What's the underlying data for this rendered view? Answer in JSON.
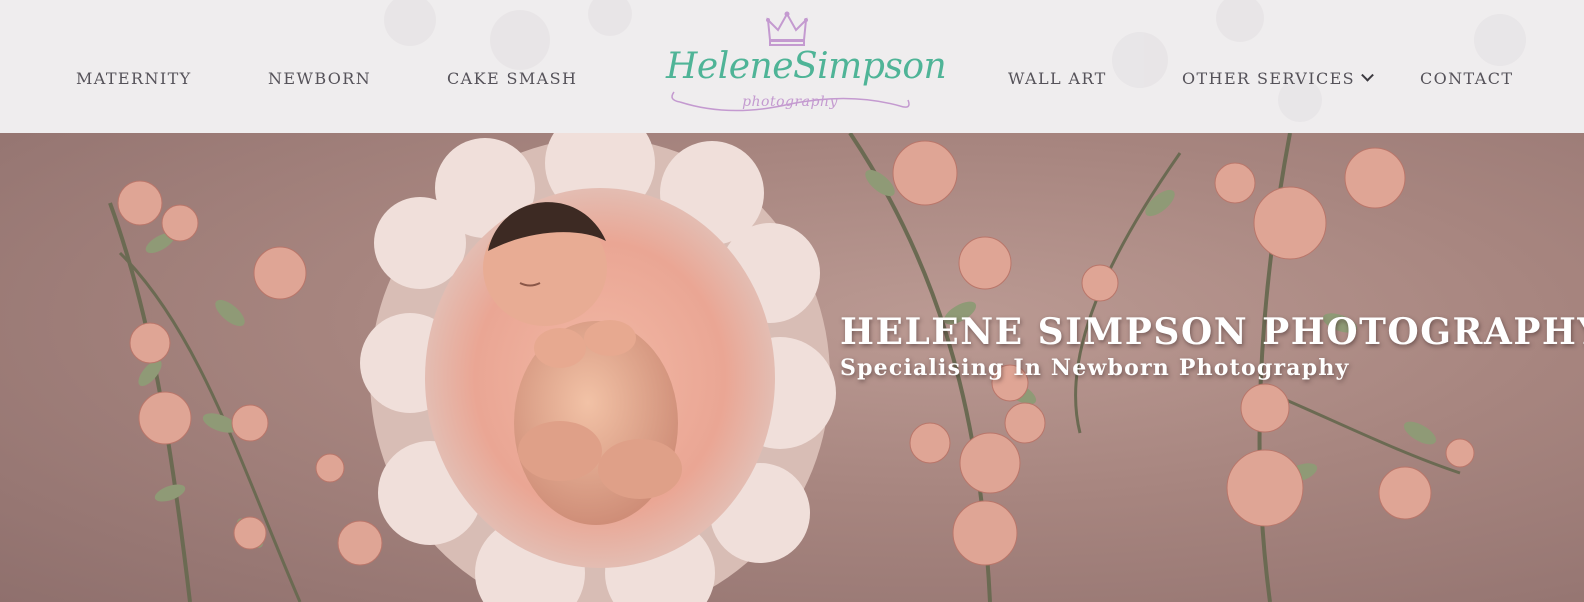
{
  "nav": {
    "left": [
      {
        "label": "MATERNITY"
      },
      {
        "label": "NEWBORN"
      },
      {
        "label": "CAKE SMASH"
      }
    ],
    "right": [
      {
        "label": "WALL ART"
      },
      {
        "label": "OTHER SERVICES",
        "icon": "chevron-down-icon"
      },
      {
        "label": "CONTACT"
      }
    ]
  },
  "logo": {
    "name": "HeleneSimpson",
    "tagline": "photography",
    "icon": "crown-icon"
  },
  "hero": {
    "title": "HELENE SIMPSON PHOTOGRAPHY",
    "subtitle": "Specialising In Newborn Photography",
    "image": "newborn-baby-in-felt-flower-nest-photo"
  },
  "colors": {
    "header_bg": "#efedee",
    "nav_text": "#555259",
    "logo_green": "#4fb497",
    "logo_lilac": "#c49ad0",
    "hero_bg": "#a3817f",
    "hero_text": "#ffffff"
  }
}
